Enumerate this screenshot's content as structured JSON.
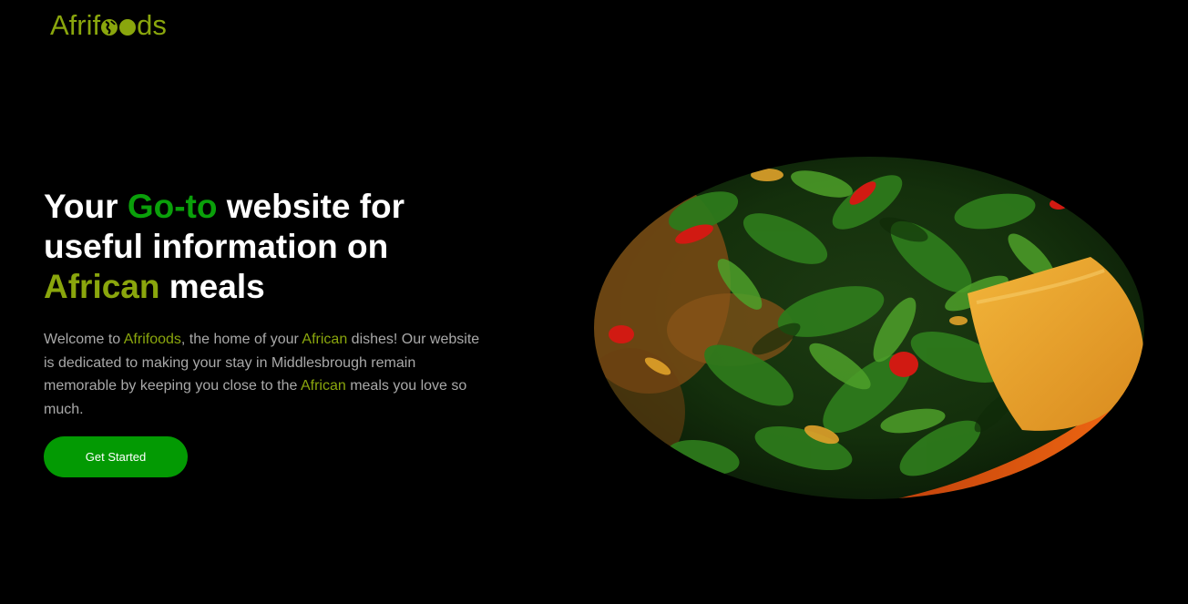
{
  "brand": {
    "name_start": "Afrif",
    "name_end": "ds",
    "color": "#8aa60d"
  },
  "hero": {
    "headline": {
      "part1": "Your ",
      "highlight1": "Go-to",
      "part2": " website for useful information on ",
      "highlight2": "African",
      "part3": " meals"
    },
    "intro": {
      "t1": "Welcome to ",
      "h1": "Afrifoods",
      "t2": ", the home of your ",
      "h2": "African",
      "t3": " dishes! Our website is dedicated to making your stay in Middlesbrough remain memorable by keeping you close to the ",
      "h3": "African",
      "t4": " meals you love so much."
    },
    "cta_label": "Get Started"
  },
  "image": {
    "subject": "african-vegetable-soup-dish"
  },
  "colors": {
    "background": "#000000",
    "accent_green": "#0aa00a",
    "accent_olive": "#8aa60d",
    "button": "#039a03",
    "body_text": "#a9a9a9"
  }
}
